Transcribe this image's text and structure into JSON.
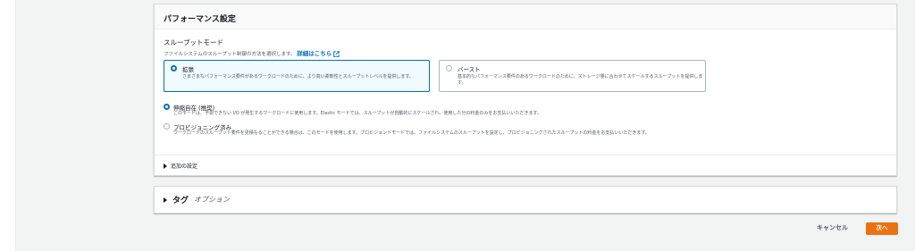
{
  "panel": {
    "title": "パフォーマンス設定",
    "throughput": {
      "label": "スループットモード",
      "description": "ファイルシステムのスループット制御の方法を選択します。",
      "learn_more": "詳細はこちら"
    },
    "tiles": [
      {
        "title": "拡張",
        "description": "さまざまなパフォーマンス要件があるワークロードのために、より高い柔軟性とスループットレベルを提供します。",
        "selected": true
      },
      {
        "title": "バースト",
        "description": "基本的なパフォーマンス要件のあるワークロードのために、ストレージ量に合わせてスケールするスループットを提供します。",
        "selected": false
      }
    ],
    "options": [
      {
        "title": "伸縮自在 (推奨)",
        "description": "このモードは、予測できない I/O が発生するワークロードに使用します。Elastic モードでは、スループットが自動的にスケールされ、使用した分の料金のみをお支払いいただきます。",
        "selected": true
      },
      {
        "title": "プロビジョニング済み",
        "description": "ワークロードのスループット要件を見積もることができる場合は、このモードを使用します。プロビジョンドモードでは、ファイルシステムのスループットを設定し、プロビジョニングされたスループットの料金をお支払いいただきます。",
        "selected": false
      }
    ],
    "additional_settings": "追加の設定"
  },
  "tags": {
    "title": "タグ",
    "optional": "オプション"
  },
  "footer": {
    "cancel": "キャンセル",
    "next": "次へ"
  },
  "colors": {
    "primary": "#ec7211",
    "link": "#0073bb"
  }
}
